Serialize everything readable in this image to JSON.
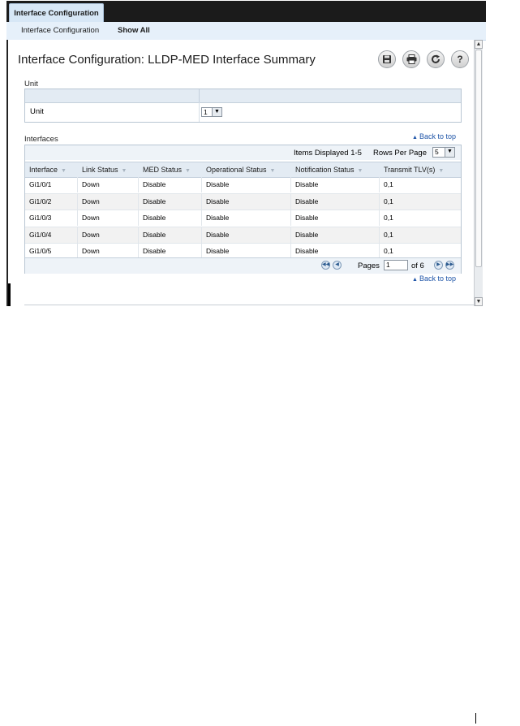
{
  "tabs": {
    "active": "Interface Configuration"
  },
  "subnav": {
    "item1": "Interface Configuration",
    "item2": "Show All"
  },
  "page": {
    "title": "Interface Configuration: LLDP-MED Interface Summary"
  },
  "toolbar": {
    "save_icon": "save-icon",
    "print_icon": "print-icon",
    "refresh_icon": "refresh-icon",
    "help_glyph": "?"
  },
  "unit_section": {
    "label": "Unit",
    "row_label": "Unit",
    "selected": "1"
  },
  "interfaces_section": {
    "label": "Interfaces",
    "back_to_top": "Back to top",
    "items_displayed": "Items Displayed 1-5",
    "rows_per_page_label": "Rows Per Page",
    "rows_per_page_value": "5",
    "columns": [
      "Interface",
      "Link Status",
      "MED Status",
      "Operational Status",
      "Notification Status",
      "Transmit TLV(s)"
    ],
    "rows": [
      [
        "Gi1/0/1",
        "Down",
        "Disable",
        "Disable",
        "Disable",
        "0,1"
      ],
      [
        "Gi1/0/2",
        "Down",
        "Disable",
        "Disable",
        "Disable",
        "0,1"
      ],
      [
        "Gi1/0/3",
        "Down",
        "Disable",
        "Disable",
        "Disable",
        "0,1"
      ],
      [
        "Gi1/0/4",
        "Down",
        "Disable",
        "Disable",
        "Disable",
        "0,1"
      ],
      [
        "Gi1/0/5",
        "Down",
        "Disable",
        "Disable",
        "Disable",
        "0,1"
      ]
    ],
    "pager": {
      "pages_label": "Pages",
      "current_page": "1",
      "of_label": "of 6"
    }
  },
  "back_to_top_bottom": "Back to top",
  "colors": {
    "link": "#1f55a8",
    "header_bg": "#e3ebf3",
    "tabbar": "#1b1b1b"
  }
}
